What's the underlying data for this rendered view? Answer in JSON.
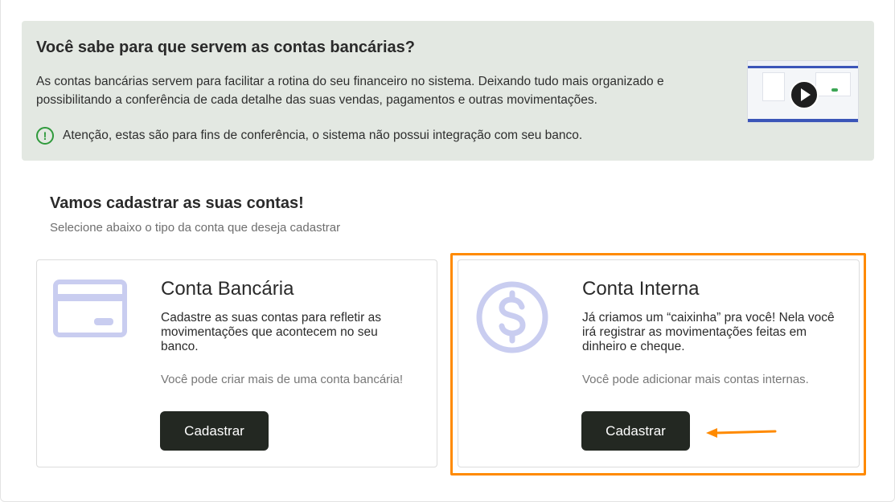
{
  "banner": {
    "title": "Você sabe para que servem as contas bancárias?",
    "description": "As contas bancárias servem para facilitar a rotina do seu financeiro no sistema. Deixando tudo mais organizado e possibilitando a conferência de cada detalhe das suas vendas, pagamentos e outras movimentações.",
    "warning": "Atenção, estas são para fins de conferência, o sistema não possui integração com seu banco.",
    "warning_icon": "!"
  },
  "section": {
    "title": "Vamos cadastrar as suas contas!",
    "subtitle": "Selecione abaixo o tipo da conta que deseja cadastrar"
  },
  "cards": [
    {
      "title": "Conta Bancária",
      "description": "Cadastre as suas contas para refletir as movimentações que acontecem no seu banco.",
      "note": "Você pode criar mais de uma conta bancária!",
      "button": "Cadastrar",
      "icon": "credit-card-icon"
    },
    {
      "title": "Conta Interna",
      "description": "Já criamos um “caixinha” pra você! Nela você irá registrar as movimentações feitas em dinheiro e cheque.",
      "note": "Você pode adicionar mais contas internas.",
      "button": "Cadastrar",
      "icon": "dollar-coin-icon"
    }
  ],
  "colors": {
    "banner_bg": "#e3e8e2",
    "accent_green": "#2f9a3c",
    "button_bg": "#232822",
    "icon_color": "#c9cdf0",
    "highlight": "#ff8a00"
  }
}
